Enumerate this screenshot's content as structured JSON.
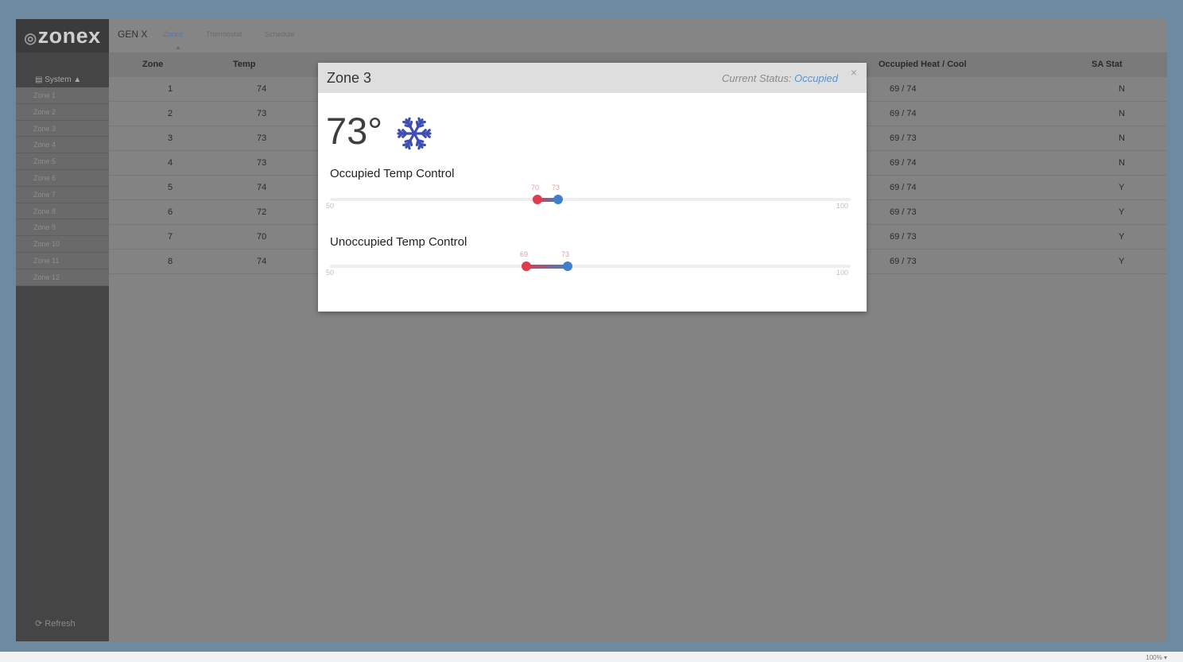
{
  "sidebar": {
    "logo": "zonex",
    "system_label": "System",
    "items": [
      "Zone 1",
      "Zone 2",
      "Zone 3",
      "Zone 4",
      "Zone 5",
      "Zone 6",
      "Zone 7",
      "Zone 8",
      "Zone 9",
      "Zone 10",
      "Zone 11",
      "Zone 12"
    ],
    "refresh_label": "Refresh"
  },
  "topbar": {
    "brand": "GEN X",
    "tabs": [
      "Zones",
      "Thermostat",
      "Schedule"
    ]
  },
  "table": {
    "headers": [
      "Zone",
      "Temp",
      "Occupied Heat / Cool",
      "SA Stat"
    ],
    "rows": [
      {
        "zone": "1",
        "temp": "74",
        "setpoint": "69 / 74",
        "sa": "N"
      },
      {
        "zone": "2",
        "temp": "73",
        "setpoint": "69 / 74",
        "sa": "N"
      },
      {
        "zone": "3",
        "temp": "73",
        "setpoint": "69 / 73",
        "sa": "N"
      },
      {
        "zone": "4",
        "temp": "73",
        "setpoint": "69 / 74",
        "sa": "N"
      },
      {
        "zone": "5",
        "temp": "74",
        "setpoint": "69 / 74",
        "sa": "Y"
      },
      {
        "zone": "6",
        "temp": "72",
        "setpoint": "69 / 73",
        "sa": "Y"
      },
      {
        "zone": "7",
        "temp": "70",
        "setpoint": "69 / 73",
        "sa": "Y"
      },
      {
        "zone": "8",
        "temp": "74",
        "setpoint": "69 / 73",
        "sa": "Y"
      }
    ]
  },
  "modal": {
    "title": "Zone 3",
    "status_prefix": "Current Status:",
    "status_value": "Occupied",
    "close": "×",
    "temperature": "73°",
    "mode_icon": "snowflake-icon",
    "occupied": {
      "label": "Occupied Temp Control",
      "min": "50",
      "max": "100",
      "low": "70",
      "high": "73"
    },
    "unoccupied": {
      "label": "Unoccupied Temp Control",
      "min": "50",
      "max": "100",
      "low": "69",
      "high": "73"
    }
  },
  "colors": {
    "heat": "#e03a4f",
    "cool": "#3f7fcc",
    "snowflake": "#3f4fb0"
  },
  "footer": {
    "zoom": "100%"
  }
}
